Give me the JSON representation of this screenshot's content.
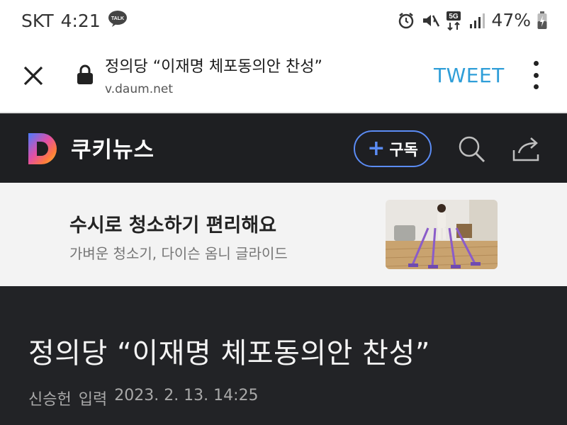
{
  "status_bar": {
    "carrier": "SKT",
    "time": "4:21",
    "talk_badge": "TALK",
    "network": "5G",
    "battery": "47%"
  },
  "browser": {
    "title": "정의당 “이재명 체포동의안 찬성”",
    "url": "v.daum.net",
    "tweet_label": "TWEET"
  },
  "channel": {
    "logo_letter": "D",
    "name": "쿠키뉴스",
    "subscribe_label": "구독",
    "accent_color": "#5b8cf5"
  },
  "ad": {
    "headline": "수시로 청소하기 편리해요",
    "subline": "가벼운 청소기, 다이슨 옴니 글라이드"
  },
  "article": {
    "title": "정의당 “이재명 체포동의안 찬성”",
    "author": "신승헌",
    "input_label": "입력",
    "date": "2023. 2. 13. 14:25"
  },
  "icons": [
    "talk-icon",
    "alarm-icon",
    "mute-icon",
    "signal-icon",
    "battery-icon",
    "close-icon",
    "lock-icon",
    "more-icon",
    "daum-logo-icon",
    "plus-icon",
    "search-icon",
    "share-icon"
  ]
}
